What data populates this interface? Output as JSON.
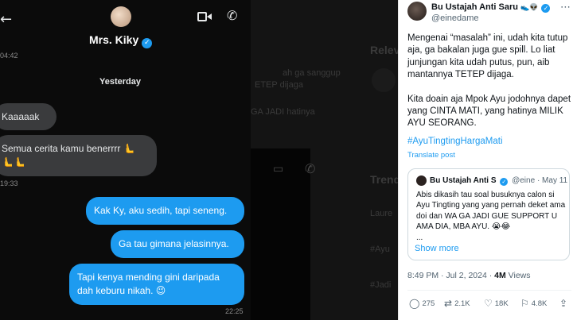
{
  "chat": {
    "contact_name": "Mrs. Kiky",
    "top_time": "04:42",
    "day_separator": "Yesterday",
    "messages_in": [
      {
        "text": "Kaaaaak"
      },
      {
        "text": "Semua cerita kamu benerrrr 🫷",
        "line2": "🫷🫷"
      }
    ],
    "time_in": "19:33",
    "messages_out": [
      {
        "text": "Kak Ky, aku sedih, tapi seneng."
      },
      {
        "text": "Ga tau gimana jelasinnya."
      },
      {
        "text": "Tapi kenya mending gini daripada",
        "line2": "dah keburu nikah. 😉"
      }
    ],
    "time_out": "22:25"
  },
  "ghost": {
    "relevant": "Relev",
    "trends": "Trend",
    "lines": [
      "ah ga sanggup",
      "ETEP dijaga",
      "GA JADI hatinya",
      "Laure",
      "#Ayu",
      "#Jadi"
    ]
  },
  "tweet": {
    "author_name": "Bu Ustajah Anti Saru",
    "author_emoji": "👟👽",
    "handle": "@einedame",
    "paragraph1": "Mengenai “masalah” ini, udah kita tutup aja, ga bakalan juga gue spill. Lo liat junjungan kita udah putus, pun, aib mantannya TETEP dijaga.",
    "paragraph2": "Kita doain aja Mpok Ayu jodohnya dapet yang CINTA MATI, yang hatinya MILIK AYU SEORANG.",
    "hashtag": "#AyuTingtingHargaMati",
    "translate": "Translate post",
    "quote": {
      "name": "Bu Ustajah Anti S",
      "handle": "@eine",
      "date": "· May 11",
      "text": "Abis dikasih tau soal busuknya calon si Ayu Tingting yang yang pernah deket ama doi dan WA GA JADI GUE SUPPORT U AMA DIA, MBA AYU. 😭😂",
      "ellipsis": "...",
      "show_more": "Show more"
    },
    "time": "8:49 PM · Jul 2, 2024 ·",
    "views_count": "4M",
    "views_label": "Views",
    "replies": "275",
    "reposts": "2.1K",
    "likes": "18K",
    "bookmarks": "4.8K"
  },
  "icons": {
    "back": "arrow-left-icon",
    "video": "video-camera-icon",
    "phone": "phone-icon",
    "more": "more-dots-icon",
    "reply": "reply-icon",
    "repost": "repost-icon",
    "like": "heart-icon",
    "bookmark": "bookmark-icon",
    "share": "share-icon"
  },
  "colors": {
    "accent": "#1d9bf0",
    "incoming_bubble": "#3a3b3d",
    "chat_background": "#0b0b0b"
  }
}
